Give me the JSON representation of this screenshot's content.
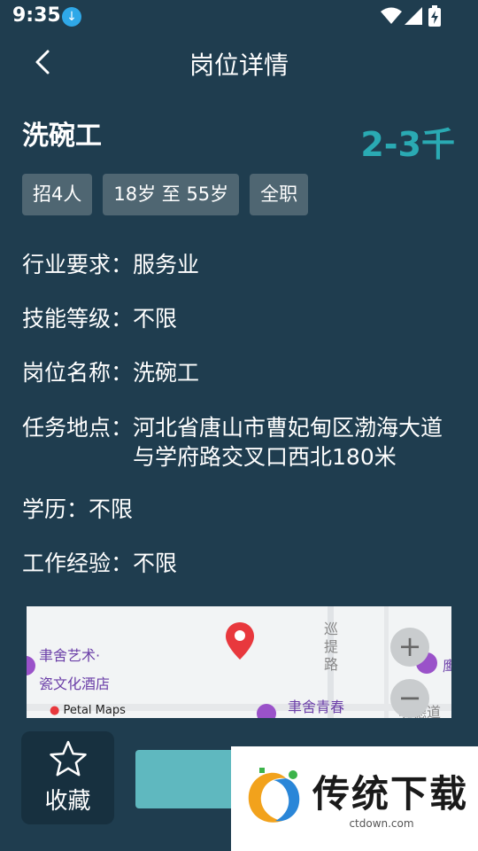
{
  "status": {
    "time": "9:35"
  },
  "header": {
    "title": "岗位详情"
  },
  "job": {
    "title": "洗碗工",
    "salary": "2-3千"
  },
  "tags": [
    "招4人",
    "18岁 至 55岁",
    "全职"
  ],
  "info": [
    {
      "label": "行业要求：",
      "value": "服务业"
    },
    {
      "label": "技能等级：",
      "value": "不限"
    },
    {
      "label": "岗位名称：",
      "value": "洗碗工"
    },
    {
      "label": "任务地点：",
      "value": "河北省唐山市曹妃甸区渤海大道与学府路交叉口西北180米"
    },
    {
      "label": "学历：",
      "value": "不限"
    },
    {
      "label": "工作经验：",
      "value": "不限"
    }
  ],
  "map": {
    "poi_hotel": "聿舍艺术·",
    "poi_hotel_2": "瓷文化酒店",
    "road_label": [
      "巡",
      "提",
      "路"
    ],
    "poi_bottom": "聿舍青春",
    "road_bottom": "明德道",
    "poi_right": "鹰",
    "provider": "Petal Maps",
    "zoom_in": "+",
    "zoom_out": "−"
  },
  "actions": {
    "favorite_label": "收藏"
  },
  "watermark": {
    "brand": "传统下载",
    "url": "ctdown.com"
  },
  "colors": {
    "background": "#1f3d4f",
    "salary": "#2aaab3",
    "apply": "#5fb8bf"
  }
}
